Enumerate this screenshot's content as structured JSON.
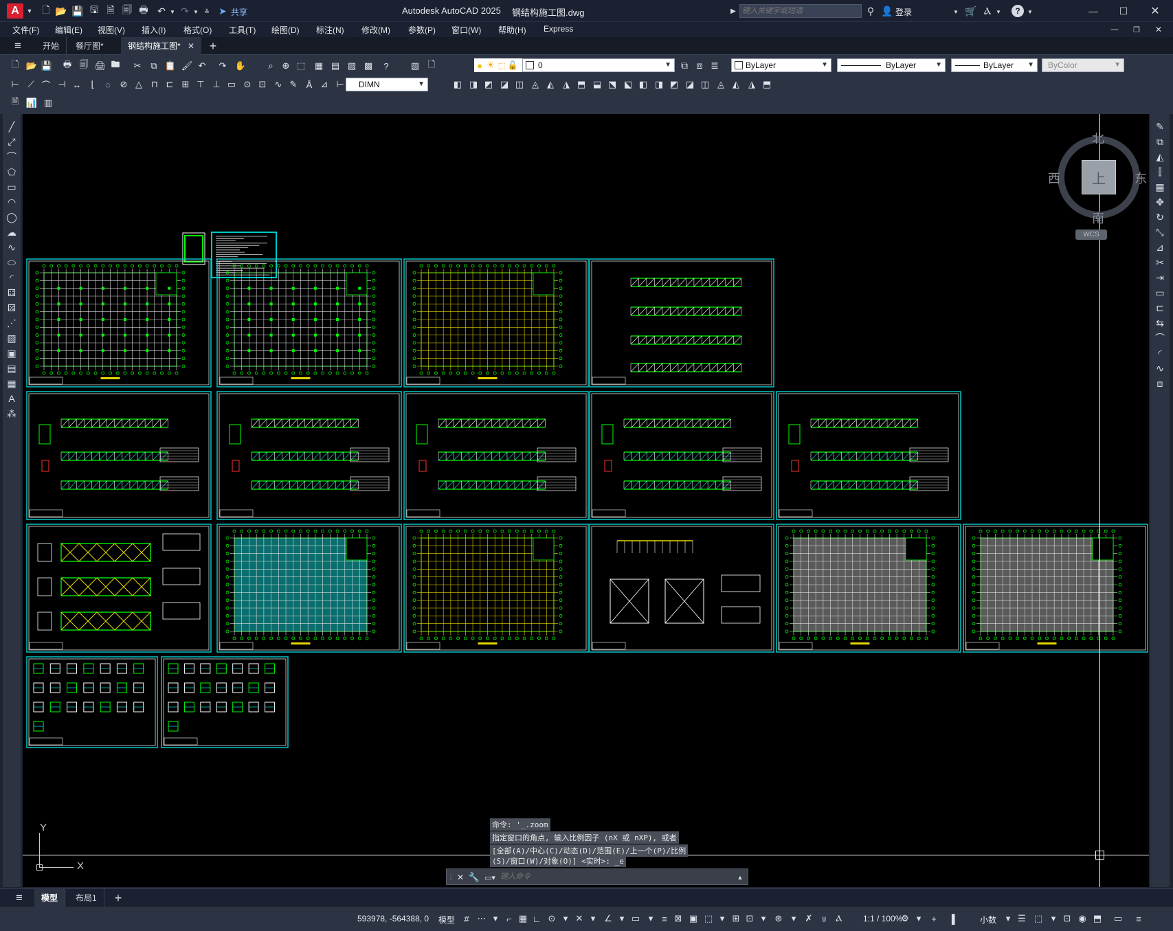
{
  "titlebar": {
    "app_letter": "A",
    "share_label": "共享",
    "title": "Autodesk AutoCAD 2025",
    "filename": "钢结构施工图.dwg",
    "search_placeholder": "键入关键字或短语",
    "login_label": "登录"
  },
  "menubar": {
    "items": [
      "文件(F)",
      "编辑(E)",
      "视图(V)",
      "插入(I)",
      "格式(O)",
      "工具(T)",
      "绘图(D)",
      "标注(N)",
      "修改(M)",
      "参数(P)",
      "窗口(W)",
      "帮助(H)",
      "Express"
    ]
  },
  "file_tabs": {
    "items": [
      "开始",
      "餐厅图*",
      "钢结构施工图*"
    ],
    "active": "钢结构施工图*"
  },
  "properties_toolbar": {
    "layer_value": "0",
    "color_value": "ByLayer",
    "linetype_value": "ByLayer",
    "lineweight_value": "ByLayer",
    "plotstyle_value": "ByColor",
    "dim_style": "DIMN"
  },
  "viewcube": {
    "north": "北",
    "south": "南",
    "east": "东",
    "west": "西",
    "top_face": "上",
    "wcs_label": "WCS"
  },
  "ucs": {
    "x_label": "X",
    "y_label": "Y"
  },
  "command_history": [
    "命令: '_.zoom",
    "指定窗口的角点, 输入比例因子 (nX 或 nXP), 或者",
    "[全部(A)/中心(C)/动态(D)/范围(E)/上一个(P)/比例",
    "(S)/窗口(W)/对象(O)] <实时>: _e"
  ],
  "command_input": {
    "placeholder": "键入命令"
  },
  "layout_tabs": {
    "items": [
      "模型",
      "布局1"
    ],
    "active": "模型"
  },
  "statusbar": {
    "coordinates": "593978, -564388, 0",
    "model_label": "模型",
    "scale_label": "1:1 / 100%",
    "units_label": "小数"
  },
  "colors": {
    "sheet_border": "#00c8c8",
    "drawing_green": "#00ff00",
    "drawing_yellow": "#e8d800",
    "canvas_bg": "#000000",
    "ui_dark": "#1b2130",
    "ui_toolbar": "#2c3444",
    "accent_red": "#d8202f"
  }
}
